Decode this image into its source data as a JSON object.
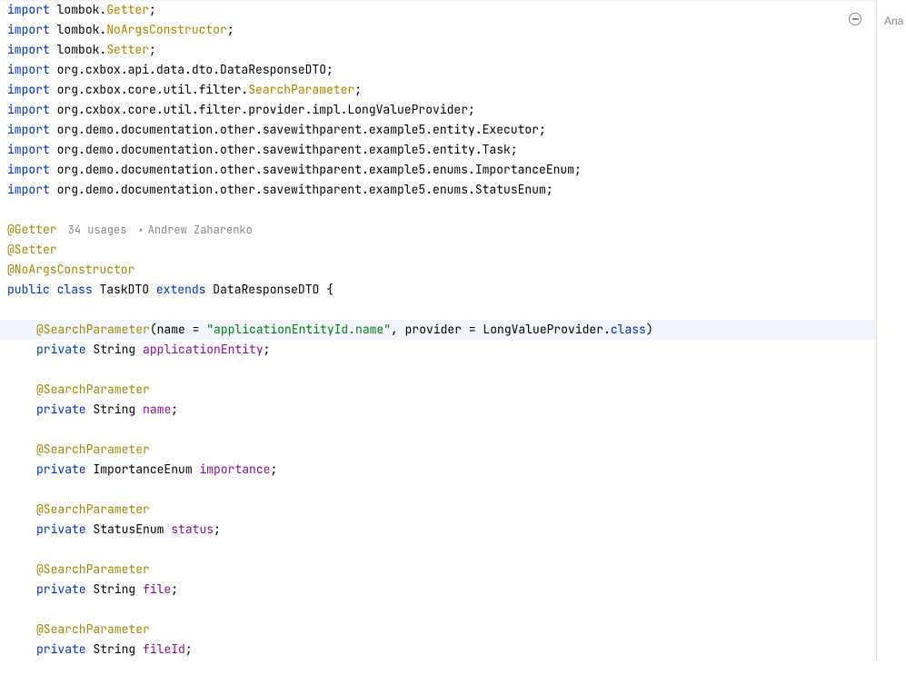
{
  "imports": [
    {
      "kw": "import",
      "pkg": "lombok.",
      "cls": "Getter",
      "clsStyle": "ref"
    },
    {
      "kw": "import",
      "pkg": "lombok.",
      "cls": "NoArgsConstructor",
      "clsStyle": "ref"
    },
    {
      "kw": "import",
      "pkg": "lombok.",
      "cls": "Setter",
      "clsStyle": "ref"
    },
    {
      "kw": "import",
      "pkg": "org.cxbox.api.data.dto.DataResponseDTO",
      "cls": "",
      "clsStyle": ""
    },
    {
      "kw": "import",
      "pkg": "org.cxbox.core.util.filter.",
      "cls": "SearchParameter",
      "clsStyle": "ref"
    },
    {
      "kw": "import",
      "pkg": "org.cxbox.core.util.filter.provider.impl.LongValueProvider",
      "cls": "",
      "clsStyle": ""
    },
    {
      "kw": "import",
      "pkg": "org.demo.documentation.other.savewithparent.example5.entity.Executor",
      "cls": "",
      "clsStyle": ""
    },
    {
      "kw": "import",
      "pkg": "org.demo.documentation.other.savewithparent.example5.entity.Task",
      "cls": "",
      "clsStyle": ""
    },
    {
      "kw": "import",
      "pkg": "org.demo.documentation.other.savewithparent.example5.enums.ImportanceEnum",
      "cls": "",
      "clsStyle": ""
    },
    {
      "kw": "import",
      "pkg": "org.demo.documentation.other.savewithparent.example5.enums.StatusEnum",
      "cls": "",
      "clsStyle": ""
    }
  ],
  "annotations": {
    "getter": "@Getter",
    "setter": "@Setter",
    "noargs": "@NoArgsConstructor",
    "search": "@SearchParameter"
  },
  "hints": {
    "usages": "34 usages",
    "author": "Andrew Zaharenko"
  },
  "classDecl": {
    "public": "public",
    "class": "class",
    "name": "TaskDTO",
    "extends": "extends",
    "parent": "DataResponseDTO",
    "brace": " {"
  },
  "searchParamLine": {
    "ann": "@SearchParameter",
    "open": "(name = ",
    "str": "\"applicationEntityId.name\"",
    "mid": ", provider = LongValueProvider.",
    "classKw": "class",
    "close": ")"
  },
  "fields": [
    {
      "mod": "private",
      "type": "String",
      "name": "applicationEntity"
    },
    {
      "mod": "private",
      "type": "String",
      "name": "name"
    },
    {
      "mod": "private",
      "type": "ImportanceEnum",
      "name": "importance"
    },
    {
      "mod": "private",
      "type": "StatusEnum",
      "name": "status"
    },
    {
      "mod": "private",
      "type": "String",
      "name": "file"
    },
    {
      "mod": "private",
      "type": "String",
      "name": "fileId"
    }
  ],
  "rightPanel": {
    "label": "Ana"
  },
  "icons": {
    "collapse": "collapse-icon",
    "person": "⊥"
  }
}
